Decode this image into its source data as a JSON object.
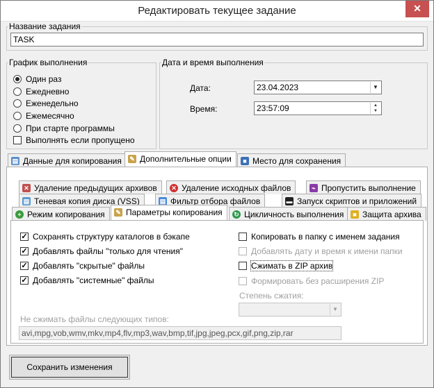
{
  "window": {
    "title": "Редактировать текущее задание",
    "close_label": "✕"
  },
  "task_name": {
    "legend": "Название задания",
    "value": "TASK"
  },
  "schedule": {
    "legend": "График выполнения",
    "options": [
      {
        "label": "Один раз",
        "checked": true
      },
      {
        "label": "Ежедневно",
        "checked": false
      },
      {
        "label": "Еженедельно",
        "checked": false
      },
      {
        "label": "Ежемесячно",
        "checked": false
      },
      {
        "label": "При старте программы",
        "checked": false
      }
    ],
    "run_if_missed_label": "Выполнять если пропущено"
  },
  "datetime": {
    "legend": "Дата и время выполнения",
    "date_label": "Дата:",
    "date_value": "23.04.2023",
    "time_label": "Время:",
    "time_value": "23:57:09"
  },
  "main_tabs": [
    {
      "label": "Данные для копирования",
      "icon": "data-copy-icon",
      "active": false
    },
    {
      "label": "Дополнительные опции",
      "icon": "options-icon",
      "active": true
    },
    {
      "label": "Место для сохранения",
      "icon": "save-location-icon",
      "active": false
    }
  ],
  "sub_tabs": {
    "row1": [
      {
        "label": "Удаление предыдущих архивов",
        "icon": "delete-archives-icon"
      },
      {
        "label": "Удаление исходных файлов",
        "icon": "delete-source-icon"
      },
      {
        "label": "Пропустить выполнение",
        "icon": "skip-run-icon"
      }
    ],
    "row2": [
      {
        "label": "Теневая копия диска (VSS)",
        "icon": "shadow-copy-icon"
      },
      {
        "label": "Фильтр отбора файлов",
        "icon": "file-filter-icon"
      },
      {
        "label": "Запуск скриптов и приложений",
        "icon": "run-scripts-icon"
      }
    ],
    "row3": [
      {
        "label": "Режим копирования",
        "icon": "copy-mode-icon",
        "active": false
      },
      {
        "label": "Параметры копирования",
        "icon": "copy-params-icon",
        "active": true
      },
      {
        "label": "Цикличность выполнения",
        "icon": "cyclic-icon",
        "active": false
      },
      {
        "label": "Защита архива",
        "icon": "archive-lock-icon",
        "active": false
      }
    ]
  },
  "copy_params": {
    "left": [
      {
        "label": "Сохранять структуру каталогов в бэкапе",
        "checked": true
      },
      {
        "label": "Добавлять файлы \"только для чтения\"",
        "checked": true
      },
      {
        "label": "Добавлять \"скрытые\" файлы",
        "checked": true
      },
      {
        "label": "Добавлять \"системные\" файлы",
        "checked": true
      }
    ],
    "right": [
      {
        "label": "Копировать в папку с именем задания",
        "checked": false,
        "disabled": false
      },
      {
        "label": "Добавлять дату и время к имени папки",
        "checked": false,
        "disabled": true
      },
      {
        "label": "Сжимать в ZIP архив",
        "checked": false,
        "disabled": false
      },
      {
        "label": "Формировать без расширения ZIP",
        "checked": false,
        "disabled": true
      }
    ],
    "compression_label": "Степень сжатия:",
    "compression_value": "",
    "exclude_label": "Не сжимать файлы следующих типов:",
    "exclude_value": "avi,mpg,vob,wmv,mkv,mp4,flv,mp3,wav,bmp,tif,jpg,jpeg,pcx,gif,png,zip,rar"
  },
  "save_button_label": "Сохранить изменения"
}
